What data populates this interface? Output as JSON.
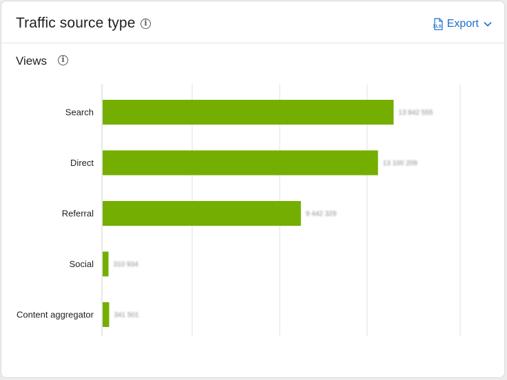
{
  "header": {
    "title": "Traffic source type",
    "export_label": "Export"
  },
  "metric": {
    "label": "Views"
  },
  "icons": {
    "info": "info-icon",
    "export_file": "xls-file-icon",
    "dropdown": "chevron-down-icon"
  },
  "colors": {
    "bar": "#74ae00",
    "accent": "#1a6fd0"
  },
  "chart_data": {
    "type": "bar",
    "orientation": "horizontal",
    "categories": [
      "Search",
      "Direct",
      "Referral",
      "Social",
      "Content aggregator"
    ],
    "values": [
      13842555,
      13100209,
      9442329,
      310934,
      341501
    ],
    "value_labels": [
      "13 842 555",
      "13 100 209",
      "9 442 329",
      "310 934",
      "341 501"
    ],
    "xlim": [
      0,
      17000000
    ],
    "grid": true,
    "legend": "none"
  }
}
